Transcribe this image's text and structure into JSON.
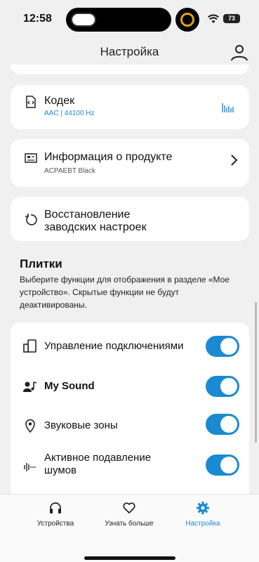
{
  "status": {
    "time": "12:58",
    "battery": "73"
  },
  "header": {
    "title": "Настройка"
  },
  "codec": {
    "title": "Кодек",
    "subtitle": "AAC | 44100 Hz"
  },
  "product_info": {
    "title": "Информация о продукте",
    "subtitle": "ACPAEBT Black"
  },
  "factory_reset": {
    "title_line1": "Восстановление",
    "title_line2": "заводских настроек"
  },
  "tiles": {
    "title": "Плитки",
    "description": "Выберите функции для отображения в разделе «Мое устройство». Скрытые функции не будут деактивированы.",
    "items": [
      {
        "label": "Управление подключениями",
        "icon": "device-connection-icon",
        "enabled": true
      },
      {
        "label": "My Sound",
        "icon": "my-sound-icon",
        "enabled": true
      },
      {
        "label": "Звуковые зоны",
        "icon": "location-pin-icon",
        "enabled": true
      },
      {
        "label_line1": "Активное подавление",
        "label_line2": "шумов",
        "icon": "noise-cancel-icon",
        "enabled": true
      }
    ]
  },
  "tabbar": {
    "tabs": [
      {
        "label": "Устройства",
        "icon": "headphones-icon"
      },
      {
        "label": "Узнать больше",
        "icon": "heart-icon"
      },
      {
        "label": "Настройка",
        "icon": "gear-icon",
        "active": true
      }
    ]
  },
  "colors": {
    "accent": "#1a8ad1",
    "background": "#f0f0f0",
    "card": "#ffffff"
  }
}
